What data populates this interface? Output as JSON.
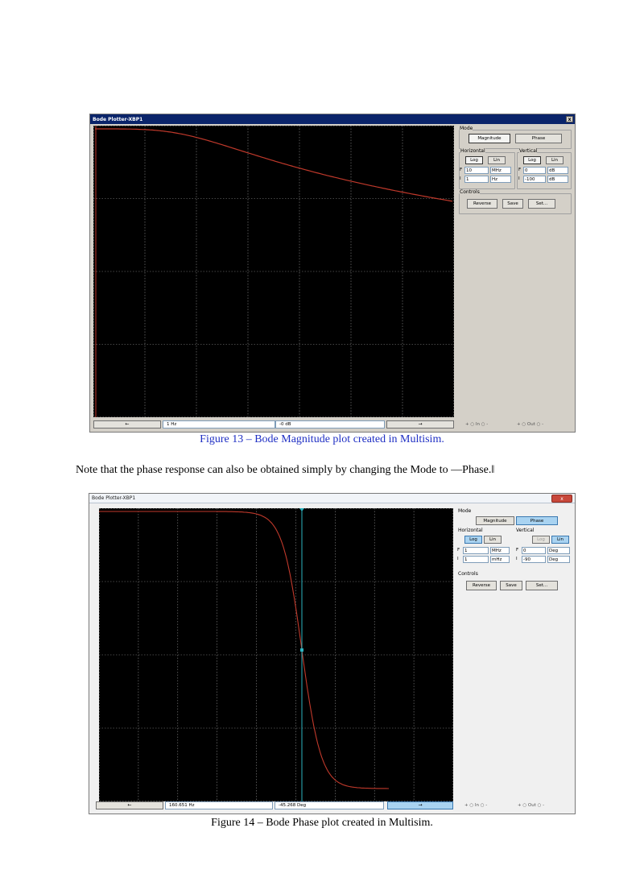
{
  "figure13": {
    "window_title": "Bode Plotter-XBP1",
    "close_glyph": "x",
    "mode": {
      "label": "Mode",
      "magnitude_label": "Magnitude",
      "phase_label": "Phase",
      "active": "magnitude"
    },
    "horizontal": {
      "label": "Horizontal",
      "log_label": "Log",
      "lin_label": "Lin",
      "f_key": "F",
      "f_value": "10",
      "f_unit": "MHz",
      "i_key": "I",
      "i_value": "1",
      "i_unit": "Hz"
    },
    "vertical": {
      "label": "Vertical",
      "log_label": "Log",
      "lin_label": "Lin",
      "f_key": "F",
      "f_value": "0",
      "f_unit": "dB",
      "i_key": "I",
      "i_value": "-100",
      "i_unit": "dB"
    },
    "controls": {
      "label": "Controls",
      "reverse_label": "Reverse",
      "save_label": "Save",
      "set_label": "Set..."
    },
    "readout": {
      "frequency": "1 Hz",
      "value": "-0 dB"
    },
    "terminals": {
      "in_text": "+ ○ In ○ -",
      "out_text": "+ ○ Out ○ -"
    },
    "caption": "Figure 13 – Bode Magnitude plot created in Multisim."
  },
  "note_text": "Note that the phase response can also be obtained simply by changing the Mode to —Phase.‖",
  "figure14": {
    "window_title": "Bode Plotter-XBP1",
    "close_glyph": "x",
    "mode": {
      "label": "Mode",
      "magnitude_label": "Magnitude",
      "phase_label": "Phase",
      "active": "phase"
    },
    "horizontal": {
      "label": "Horizontal",
      "log_label": "Log",
      "lin_label": "Lin",
      "f_key": "F",
      "f_value": "1",
      "f_unit": "MHz",
      "i_key": "I",
      "i_value": "1",
      "i_unit": "mHz"
    },
    "vertical": {
      "label": "Vertical",
      "log_label": "Log",
      "lin_label": "Lin",
      "f_key": "F",
      "f_value": "0",
      "f_unit": "Deg",
      "i_key": "I",
      "i_value": "-90",
      "i_unit": "Deg"
    },
    "controls": {
      "label": "Controls",
      "reverse_label": "Reverse",
      "save_label": "Save",
      "set_label": "Set..."
    },
    "readout": {
      "frequency": "160.651 Hz",
      "value": "-45.268 Deg"
    },
    "terminals": {
      "in_text": "+ ○ In ○ -",
      "out_text": "+ ○ Out ○ -"
    },
    "caption": "Figure 14 – Bode Phase plot created in Multisim."
  },
  "colors": {
    "trace": "#c0392b",
    "grid": "#8a8a8a",
    "cursor": "#2bb3c0",
    "caption13": "#1f2fc4"
  }
}
